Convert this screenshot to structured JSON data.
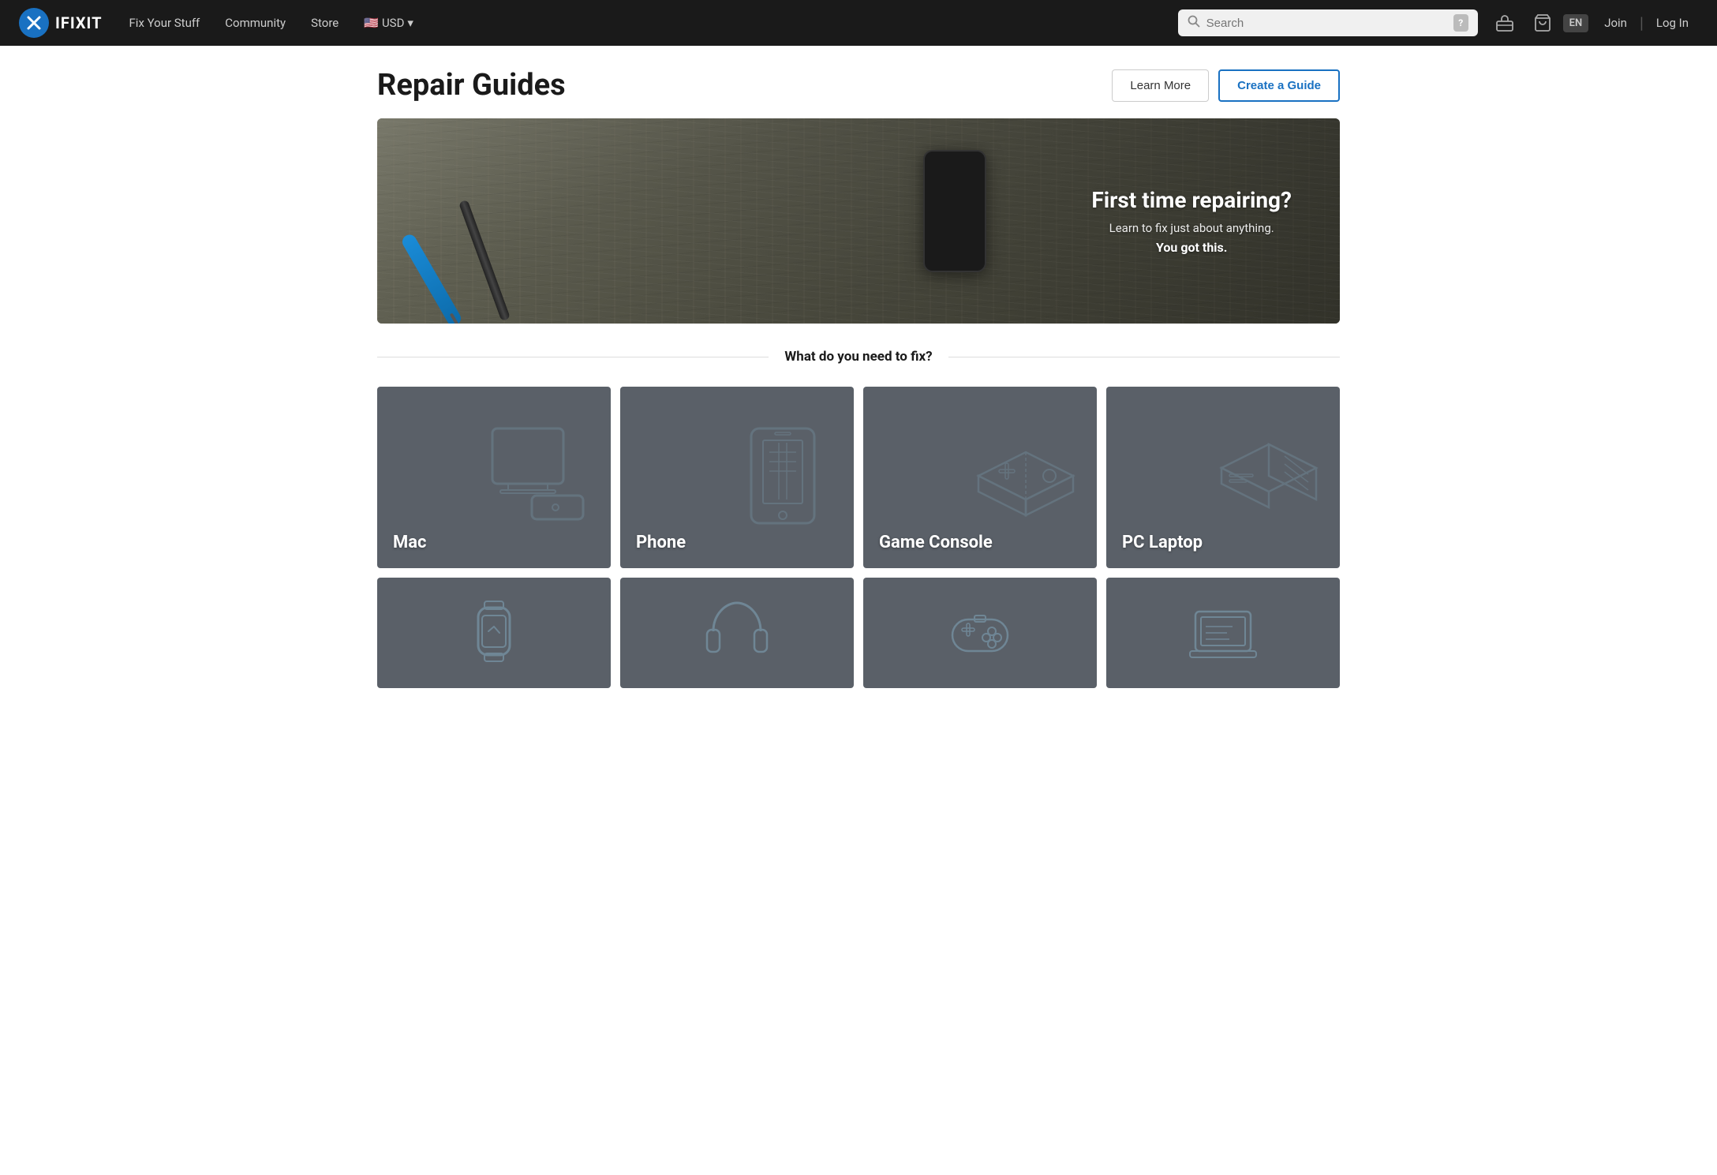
{
  "nav": {
    "logo_text": "IFIXIT",
    "logo_icon": "✕",
    "links": [
      {
        "id": "fix-your-stuff",
        "label": "Fix Your Stuff"
      },
      {
        "id": "community",
        "label": "Community"
      },
      {
        "id": "store",
        "label": "Store"
      }
    ],
    "currency": "USD",
    "currency_flag": "🇺🇸",
    "search_placeholder": "Search",
    "search_shortcut": "?",
    "lang": "EN",
    "join": "Join",
    "login": "Log In"
  },
  "page": {
    "title": "Repair Guides",
    "learn_more": "Learn More",
    "create_guide": "Create a Guide"
  },
  "hero": {
    "heading": "First time repairing?",
    "sub": "Learn to fix just about anything.",
    "emphasis": "You got this."
  },
  "section": {
    "divider_text": "What do you need to fix?"
  },
  "categories": [
    {
      "id": "mac",
      "label": "Mac",
      "icon": "mac"
    },
    {
      "id": "phone",
      "label": "Phone",
      "icon": "phone"
    },
    {
      "id": "game-console",
      "label": "Game Console",
      "icon": "game-console"
    },
    {
      "id": "pc-laptop",
      "label": "PC Laptop",
      "icon": "pc-laptop"
    },
    {
      "id": "appliance",
      "label": "",
      "icon": "appliance"
    },
    {
      "id": "tablet",
      "label": "",
      "icon": "tablet"
    },
    {
      "id": "camera",
      "label": "",
      "icon": "camera"
    },
    {
      "id": "pc-desktop",
      "label": "",
      "icon": "pc-desktop"
    }
  ]
}
